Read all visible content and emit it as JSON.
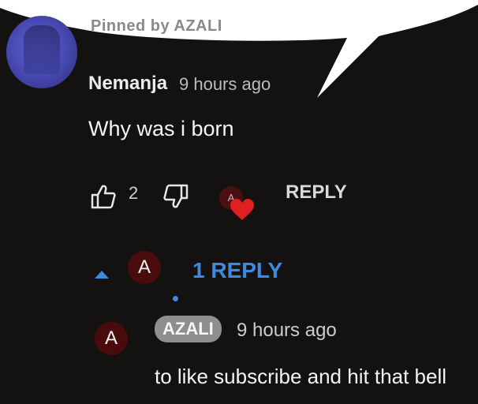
{
  "pinned": {
    "text": "Pinned by AZALI"
  },
  "comment": {
    "author": "Nemanja",
    "time": "9 hours ago",
    "text": "Why was i born",
    "like_count": "2",
    "reply_label": "REPLY",
    "heart_avatar_letter": "A"
  },
  "replies": {
    "toggle_label": "1 REPLY",
    "avatar_letter": "A",
    "items": [
      {
        "avatar_letter": "A",
        "author": "AZALI",
        "time": "9 hours ago",
        "text": "to like subscribe and hit that bell"
      }
    ]
  },
  "colors": {
    "background": "#141111",
    "link_blue": "#3f89e0",
    "heart_red": "#e02020",
    "avatar_maroon": "#4a0b0c",
    "author_badge": "#8e8e8e"
  },
  "icons": [
    "thumbs-up-icon",
    "thumbs-down-icon",
    "heart-icon",
    "caret-up-icon"
  ]
}
